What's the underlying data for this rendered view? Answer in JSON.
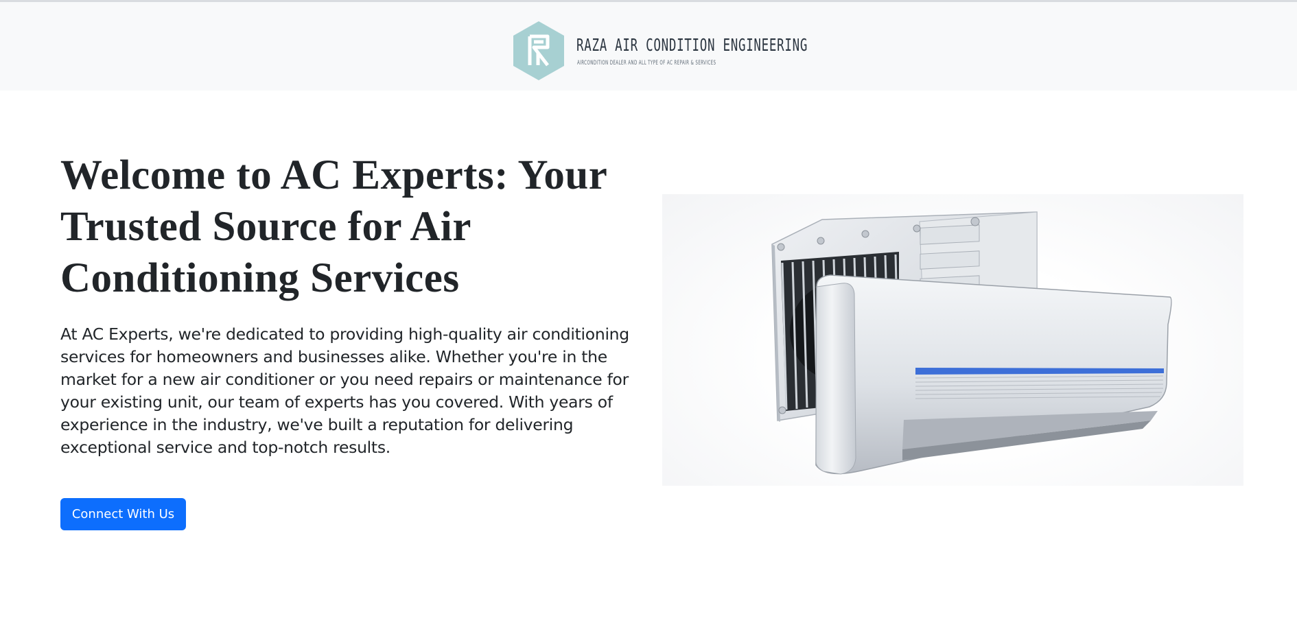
{
  "header": {
    "brand_title": "RAZA AIR CONDITION ENGINEERING",
    "brand_tagline": "AIRCONDITION DEALER AND ALL TYPE OF AC REPAIR & SERVICES",
    "logo_color": "#a7d0d2"
  },
  "hero": {
    "title": "Welcome to AC Experts: Your Trusted Source for Air Conditioning Services",
    "description": "At AC Experts, we're dedicated to providing high-quality air conditioning services for homeowners and businesses alike. Whether you're in the market for a new air conditioner or you need repairs or maintenance for your existing unit, our team of experts has you covered. With years of experience in the industry, we've built a reputation for delivering exceptional service and top-notch results.",
    "cta_label": "Connect With Us",
    "cta_color": "#0d6efd",
    "image": "air-conditioner-split-unit-image"
  }
}
